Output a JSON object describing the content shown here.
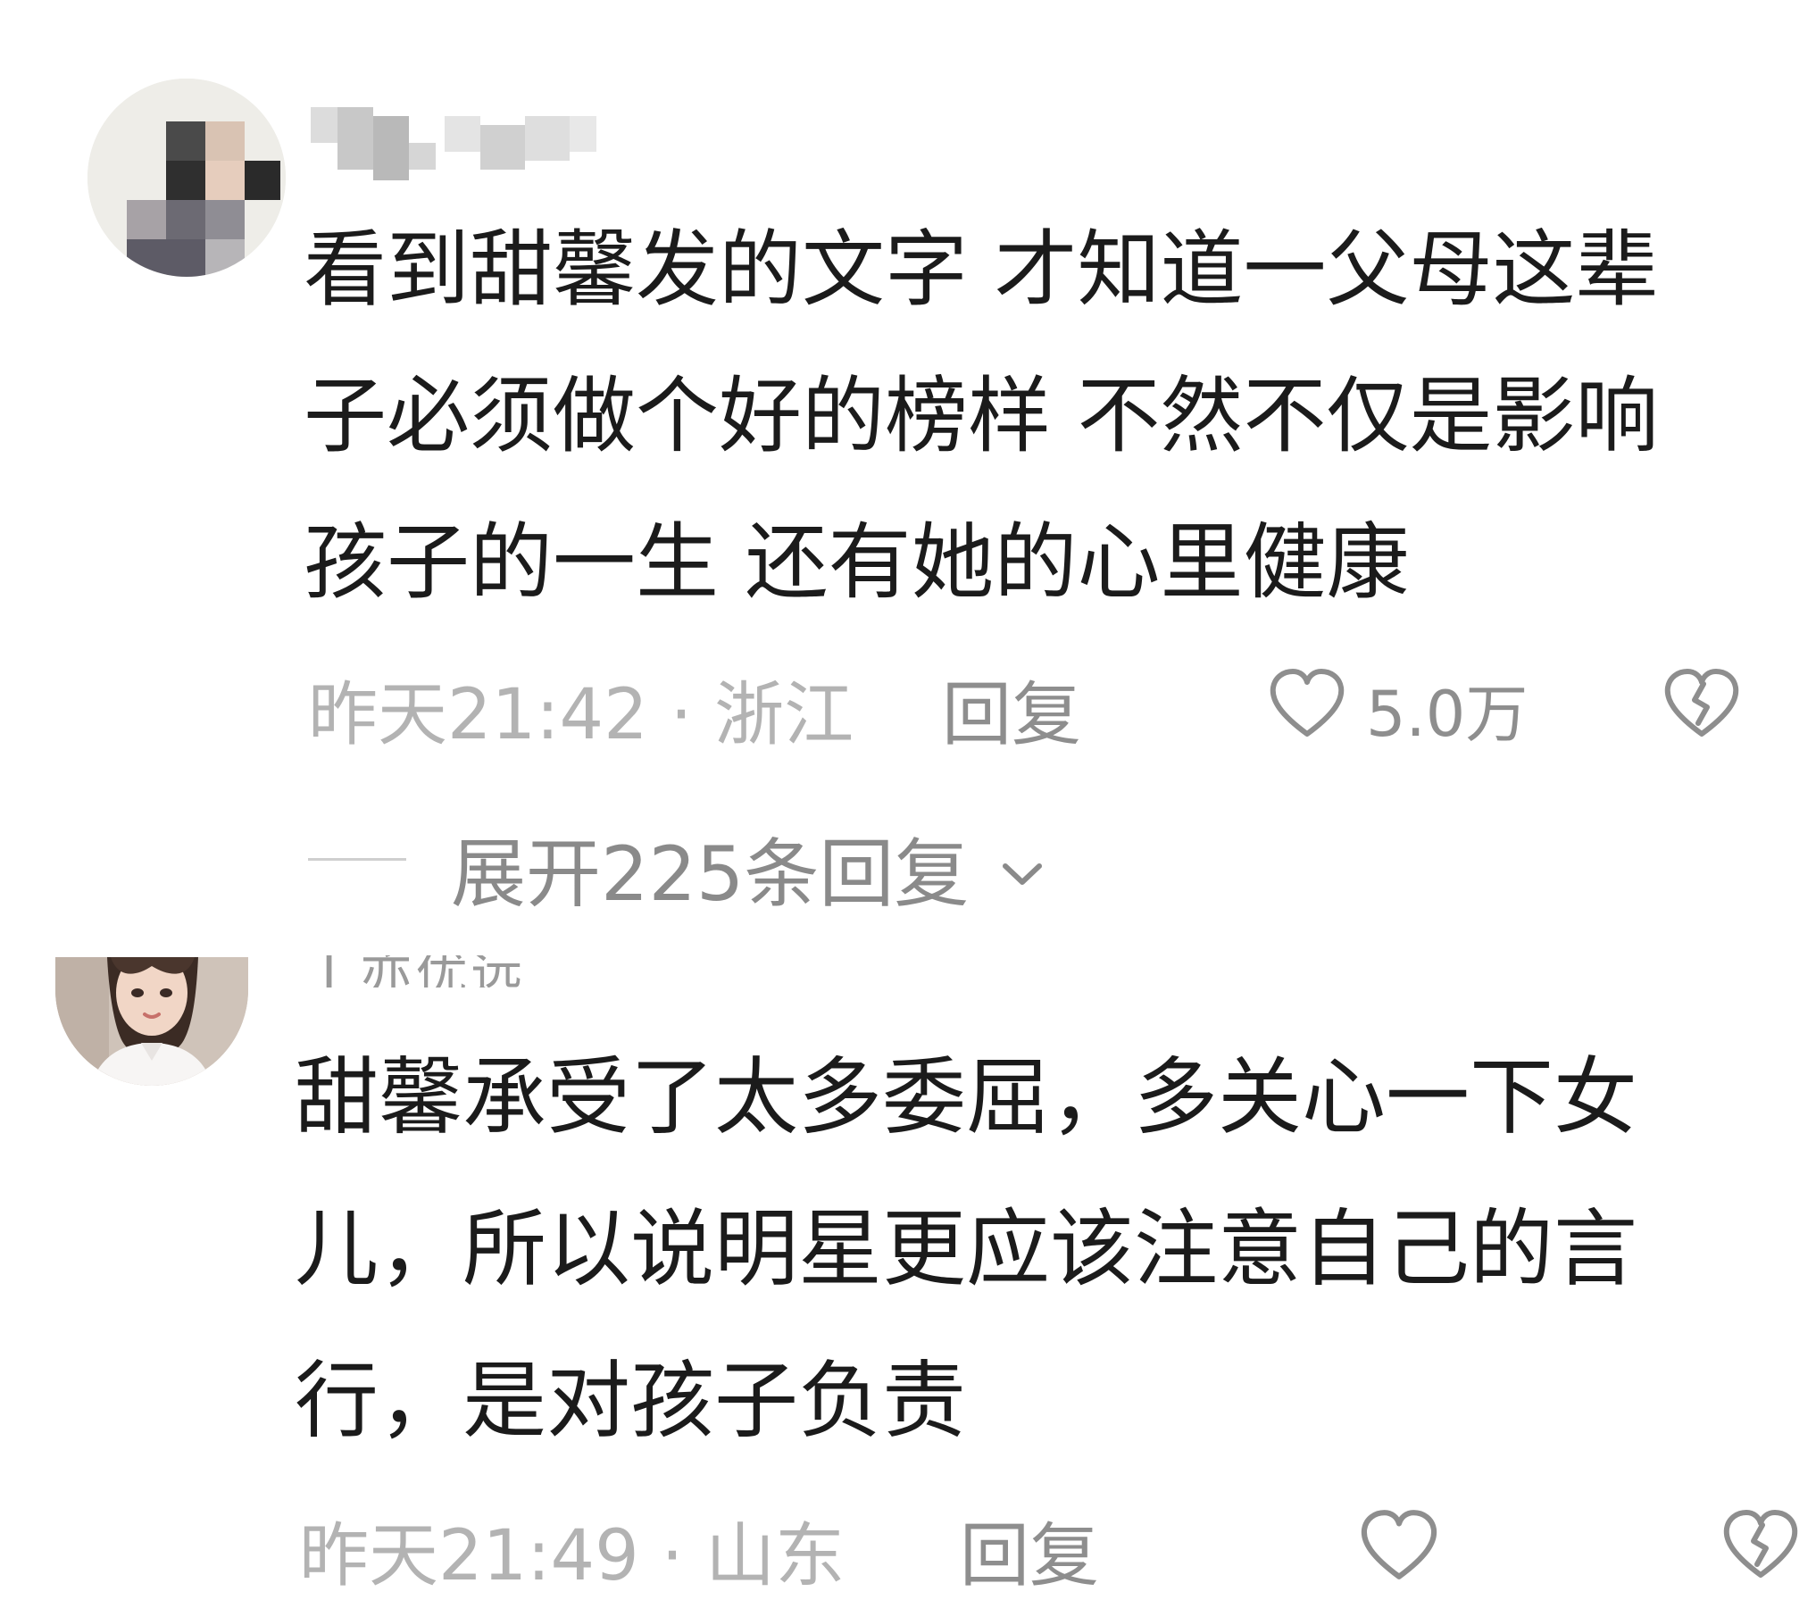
{
  "comments": [
    {
      "text_lines": [
        "看到甜馨发的文字 才知道一父母这辈",
        "子必须做个好的榜样 不然不仅是影响",
        "孩子的一生 还有她的心里健康"
      ],
      "time_location": "昨天21:42 · 浙江",
      "reply_label": "回复",
      "like_count": "5.0万",
      "expand_replies": "展开225条回复"
    },
    {
      "text_lines": [
        "甜馨承受了太多委屈，多关心一下女",
        "儿，所以说明星更应该注意自己的言",
        "行，是对孩子负责"
      ],
      "time_location": "昨天21:49 · 山东",
      "reply_label": "回复",
      "username_partial": "I 亦优远"
    }
  ],
  "icons": [
    "heart-outline-icon",
    "broken-heart-icon",
    "chevron-down-icon"
  ],
  "colors": {
    "text_primary": "#1b1b1b",
    "text_meta": "#b3b3b3",
    "text_action": "#8e8e8e",
    "background": "#ffffff"
  }
}
